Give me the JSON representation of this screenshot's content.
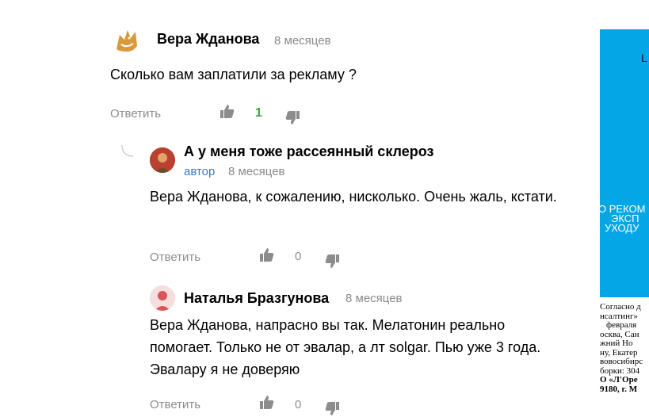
{
  "comments": [
    {
      "author": "Вера Жданова",
      "time": "8 месяцев",
      "text": "Сколько вам заплатили за рекламу ?",
      "reply_label": "Ответить",
      "likes": "1"
    },
    {
      "author": "А у меня тоже рассеянный склероз",
      "badge": "автор",
      "time": "8 месяцев",
      "text": "Вера Жданова, к сожалению, нисколько. Очень жаль, кстати.",
      "reply_label": "Ответить",
      "likes": "0"
    },
    {
      "author": "Наталья Бразгунова",
      "time": "8 месяцев",
      "text": "Вера Жданова, напрасно вы так. Мелатонин реально помогает. Только не от эвалар, а лт solgar. Пью уже 3 года. Эвалару я не доверяю",
      "reply_label": "Ответить",
      "likes": "0"
    }
  ],
  "ad": {
    "letter": "L",
    "lines": [
      "О РЕКОМ",
      "ЭКСП",
      "УХОДУ"
    ],
    "fine_print": [
      "Согласно д",
      "нсалтинг»",
      "февраля",
      "осква, Сан",
      "жний  Но",
      "ну, Екатер",
      "вовосибирс",
      "борки: 304",
      "О «Л'Оре",
      "9180, г. М"
    ]
  },
  "colors": {
    "like_green": "#3aa63a",
    "author_blue": "#3b78c5",
    "ad_blue": "#05a6e6",
    "muted": "#8c8c8c"
  }
}
